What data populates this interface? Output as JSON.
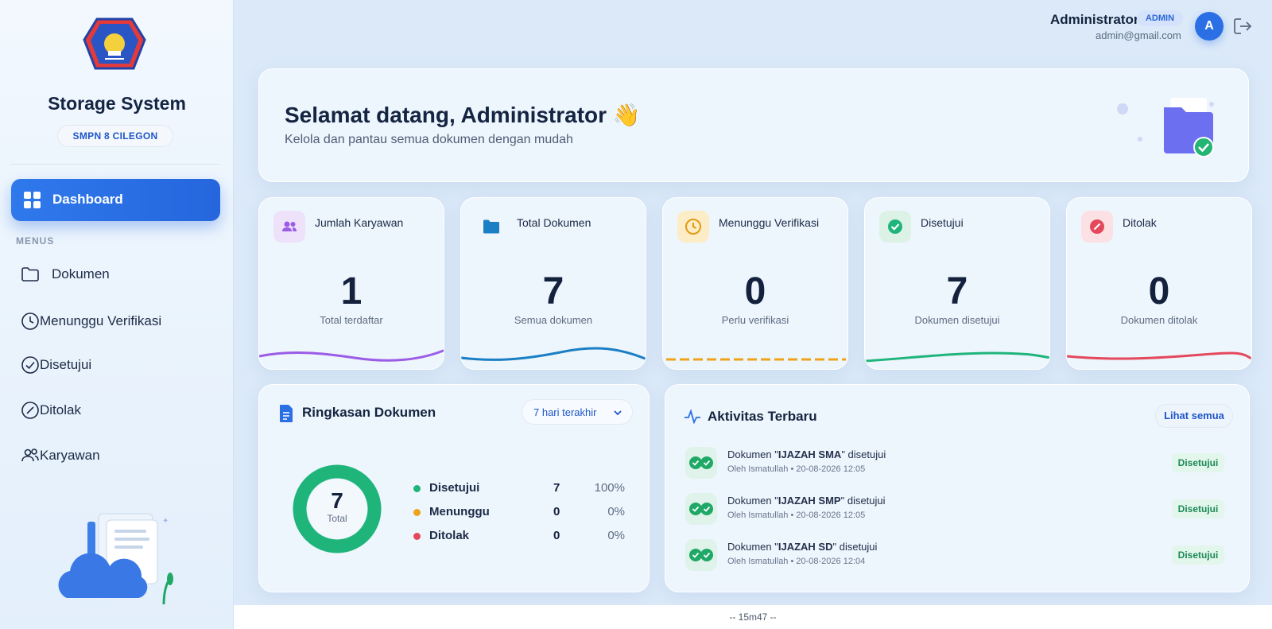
{
  "sidebar": {
    "brand_title": "Storage System",
    "school": "SMPN 8 CILEGON",
    "active_item": "Dashboard",
    "menus_label": "MENUS",
    "items": [
      {
        "label": "Dokumen",
        "icon": "folder-icon"
      },
      {
        "label": "Menunggu Verifikasi",
        "icon": "clock-icon"
      },
      {
        "label": "Disetujui",
        "icon": "check-circle-icon"
      },
      {
        "label": "Ditolak",
        "icon": "slash-circle-icon"
      },
      {
        "label": "Karyawan",
        "icon": "users-icon"
      }
    ]
  },
  "header": {
    "user_name": "Administrator",
    "role_badge": "ADMIN",
    "email": "admin@gmail.com",
    "avatar_initial": "A"
  },
  "welcome": {
    "title": "Selamat datang, Administrator 👋",
    "subtitle": "Kelola dan pantau semua dokumen dengan mudah"
  },
  "stats": [
    {
      "title": "Jumlah Karyawan",
      "value": "1",
      "subtitle": "Total terdaftar",
      "color": "#9b5ce6",
      "icon": "users-icon"
    },
    {
      "title": "Total Dokumen",
      "value": "7",
      "subtitle": "Semua dokumen",
      "color": "#1a7fc4",
      "icon": "folder-icon"
    },
    {
      "title": "Menunggu Verifikasi",
      "value": "0",
      "subtitle": "Perlu verifikasi",
      "color": "#f0a21a",
      "icon": "clock-icon"
    },
    {
      "title": "Disetujui",
      "value": "7",
      "subtitle": "Dokumen disetujui",
      "color": "#1fb57a",
      "icon": "check-circle-icon"
    },
    {
      "title": "Ditolak",
      "value": "0",
      "subtitle": "Dokumen ditolak",
      "color": "#e5485b",
      "icon": "slash-circle-icon"
    }
  ],
  "summary": {
    "title": "Ringkasan Dokumen",
    "range": "7 hari terakhir",
    "total_value": "7",
    "total_label": "Total",
    "legend": [
      {
        "name": "Disetujui",
        "count": "7",
        "pct": "100%",
        "color": "#1fb57a"
      },
      {
        "name": "Menunggu",
        "count": "0",
        "pct": "0%",
        "color": "#f0a21a"
      },
      {
        "name": "Ditolak",
        "count": "0",
        "pct": "0%",
        "color": "#e5485b"
      }
    ]
  },
  "activity": {
    "title": "Aktivitas Terbaru",
    "see_all": "Lihat semua",
    "items": [
      {
        "prefix": "Dokumen \"",
        "doc": "IJAZAH SMA",
        "suffix": "\" disetujui",
        "meta": "Oleh Ismatullah • 20-08-2026 12:05",
        "badge": "Disetujui"
      },
      {
        "prefix": "Dokumen \"",
        "doc": "IJAZAH SMP",
        "suffix": "\" disetujui",
        "meta": "Oleh Ismatullah • 20-08-2026 12:05",
        "badge": "Disetujui"
      },
      {
        "prefix": "Dokumen \"",
        "doc": "IJAZAH SD",
        "suffix": "\" disetujui",
        "meta": "Oleh Ismatullah • 20-08-2026 12:04",
        "badge": "Disetujui"
      }
    ]
  },
  "footer": {
    "text": "-- 15m47 --"
  }
}
